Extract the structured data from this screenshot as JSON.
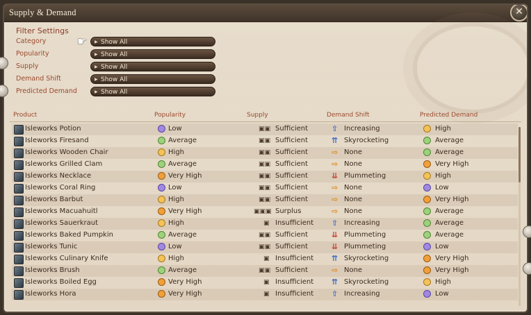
{
  "window": {
    "title": "Supply & Demand",
    "close_icon": "close-icon"
  },
  "filters": {
    "title": "Filter Settings",
    "rows": [
      {
        "label": "Category",
        "value": "Show All"
      },
      {
        "label": "Popularity",
        "value": "Show All"
      },
      {
        "label": "Supply",
        "value": "Show All"
      },
      {
        "label": "Demand Shift",
        "value": "Show All"
      },
      {
        "label": "Predicted Demand",
        "value": "Show All"
      }
    ]
  },
  "table": {
    "headers": {
      "product": "Product",
      "popularity": "Popularity",
      "supply": "Supply",
      "demand_shift": "Demand Shift",
      "predicted_demand": "Predicted Demand"
    },
    "rows": [
      {
        "product": "Isleworks Potion",
        "popularity": "Low",
        "supply": "Sufficient",
        "shift": "Increasing",
        "predicted": "High"
      },
      {
        "product": "Isleworks Firesand",
        "popularity": "Average",
        "supply": "Sufficient",
        "shift": "Skyrocketing",
        "predicted": "Average"
      },
      {
        "product": "Isleworks Wooden Chair",
        "popularity": "High",
        "supply": "Sufficient",
        "shift": "None",
        "predicted": "Average"
      },
      {
        "product": "Isleworks Grilled Clam",
        "popularity": "Average",
        "supply": "Sufficient",
        "shift": "None",
        "predicted": "Very High"
      },
      {
        "product": "Isleworks Necklace",
        "popularity": "Very High",
        "supply": "Sufficient",
        "shift": "Plummeting",
        "predicted": "High"
      },
      {
        "product": "Isleworks Coral Ring",
        "popularity": "Low",
        "supply": "Sufficient",
        "shift": "None",
        "predicted": "Low"
      },
      {
        "product": "Isleworks Barbut",
        "popularity": "High",
        "supply": "Sufficient",
        "shift": "None",
        "predicted": "Very High"
      },
      {
        "product": "Isleworks Macuahuitl",
        "popularity": "Very High",
        "supply": "Surplus",
        "shift": "None",
        "predicted": "Average"
      },
      {
        "product": "Isleworks Sauerkraut",
        "popularity": "High",
        "supply": "Insufficient",
        "shift": "Increasing",
        "predicted": "Average"
      },
      {
        "product": "Isleworks Baked Pumpkin",
        "popularity": "Average",
        "supply": "Sufficient",
        "shift": "Plummeting",
        "predicted": "Average"
      },
      {
        "product": "Isleworks Tunic",
        "popularity": "Low",
        "supply": "Sufficient",
        "shift": "Plummeting",
        "predicted": "Low"
      },
      {
        "product": "Isleworks Culinary Knife",
        "popularity": "High",
        "supply": "Insufficient",
        "shift": "Skyrocketing",
        "predicted": "Very High"
      },
      {
        "product": "Isleworks Brush",
        "popularity": "Average",
        "supply": "Sufficient",
        "shift": "None",
        "predicted": "Very High"
      },
      {
        "product": "Isleworks Boiled Egg",
        "popularity": "Very High",
        "supply": "Insufficient",
        "shift": "Skyrocketing",
        "predicted": "High"
      },
      {
        "product": "Isleworks Hora",
        "popularity": "Very High",
        "supply": "Insufficient",
        "shift": "Increasing",
        "predicted": "Low"
      }
    ]
  },
  "colors": {
    "accent_text": "#9a4a2e",
    "header_bg": "#3f3328",
    "panel_bg": "#e5d9c7"
  }
}
